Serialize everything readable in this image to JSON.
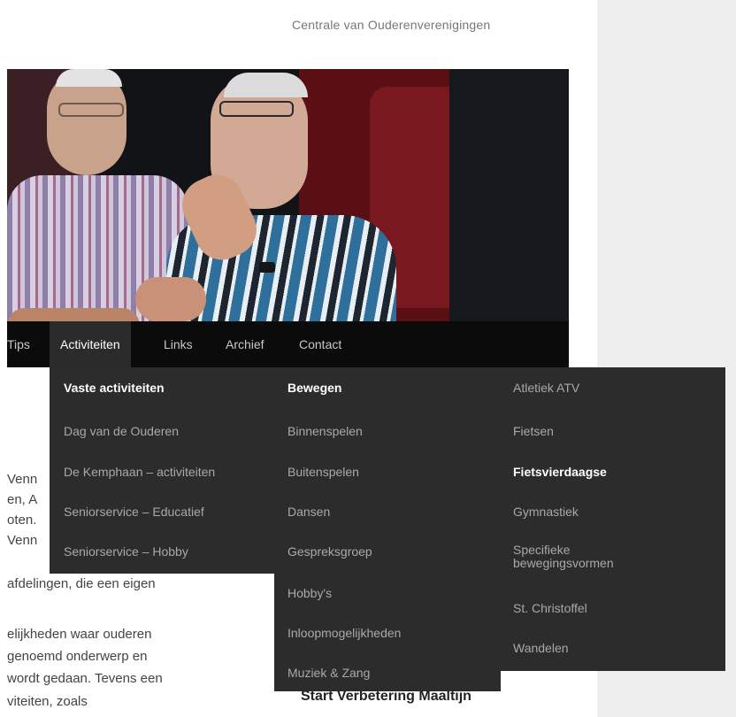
{
  "site": {
    "org_name": "Centrale van Ouderenverenigingen"
  },
  "nav": {
    "items": [
      "Tips",
      "Activiteiten",
      "Links",
      "Archief",
      "Contact"
    ],
    "active": "Activiteiten"
  },
  "body_text": {
    "lines": [
      "Venn",
      "en, A",
      "oten.",
      "Venn",
      "afdelingen, die een eigen",
      "elijkheden waar ouderen",
      "genoemd onderwerp en",
      "wordt gedaan. Tevens een",
      "viteiten, zoals"
    ],
    "heading": "Start Verbetering Maaltijn"
  },
  "mega_menu": {
    "col1": {
      "heading": "Vaste activiteiten",
      "items": [
        "Dag van de Ouderen",
        "De Kemphaan – activiteiten",
        "Seniorservice – Educatief",
        "Seniorservice – Hobby"
      ]
    },
    "col2": {
      "heading": "Bewegen",
      "items": [
        "Binnenspelen",
        "Buitenspelen",
        "Dansen",
        "Gespreksgroep",
        "Hobby's",
        "Inloopmogelijkheden",
        "Muziek & Zang"
      ]
    },
    "col3": {
      "items": [
        "Atletiek ATV",
        "Fietsen",
        "Fietsvierdaagse",
        "Gymnastiek",
        "Specifieke bewegingsvormen",
        "St. Christoffel",
        "Wandelen"
      ],
      "highlighted": "Fietsvierdaagse"
    }
  },
  "colors": {
    "navbar_bg": "#0b0b0b",
    "menu_bg": "#2c2c2c",
    "sidebar_bg": "#eeeeee",
    "menu_text": "#a9a9a9",
    "menu_highlight": "#ffffff"
  }
}
